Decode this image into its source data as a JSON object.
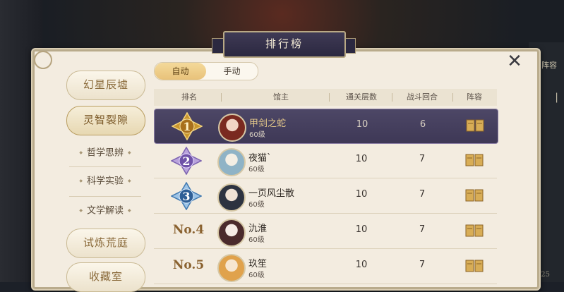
{
  "window": {
    "title": "排行榜"
  },
  "background": {
    "right_label": "阵容",
    "right_label2": "|",
    "right_number": "25"
  },
  "sidebar": {
    "items": [
      {
        "label": "幻星辰墟",
        "type": "button",
        "active": false
      },
      {
        "label": "灵智裂隙",
        "type": "button",
        "active": true
      },
      {
        "label": "哲学思辨",
        "type": "sub"
      },
      {
        "label": "科学实验",
        "type": "sub"
      },
      {
        "label": "文学解读",
        "type": "sub"
      },
      {
        "label": "试炼荒庭",
        "type": "button",
        "active": false
      },
      {
        "label": "收藏室",
        "type": "button",
        "active": false
      }
    ]
  },
  "tabs": [
    {
      "label": "自动",
      "active": true
    },
    {
      "label": "手动",
      "active": false
    }
  ],
  "table": {
    "headers": [
      "排名",
      "馆主",
      "通关层数",
      "战斗回合",
      "阵容"
    ],
    "rows": [
      {
        "rank": "1",
        "rank_text": "",
        "name": "甲剑之蛇",
        "level": "60级",
        "floors": "10",
        "rounds": "6",
        "highlight": true
      },
      {
        "rank": "2",
        "rank_text": "",
        "name": "夜猫`",
        "level": "60级",
        "floors": "10",
        "rounds": "7",
        "highlight": false
      },
      {
        "rank": "3",
        "rank_text": "",
        "name": "一页风尘散",
        "level": "60级",
        "floors": "10",
        "rounds": "7",
        "highlight": false
      },
      {
        "rank": "",
        "rank_text": "No.4",
        "name": "氿淮",
        "level": "60级",
        "floors": "10",
        "rounds": "7",
        "highlight": false
      },
      {
        "rank": "",
        "rank_text": "No.5",
        "name": "玖笙",
        "level": "60级",
        "floors": "10",
        "rounds": "7",
        "highlight": false
      }
    ]
  },
  "colors": {
    "accent_gold": "#e8c27a",
    "highlight_row": "#4d4766",
    "panel": "#f3ece0"
  }
}
